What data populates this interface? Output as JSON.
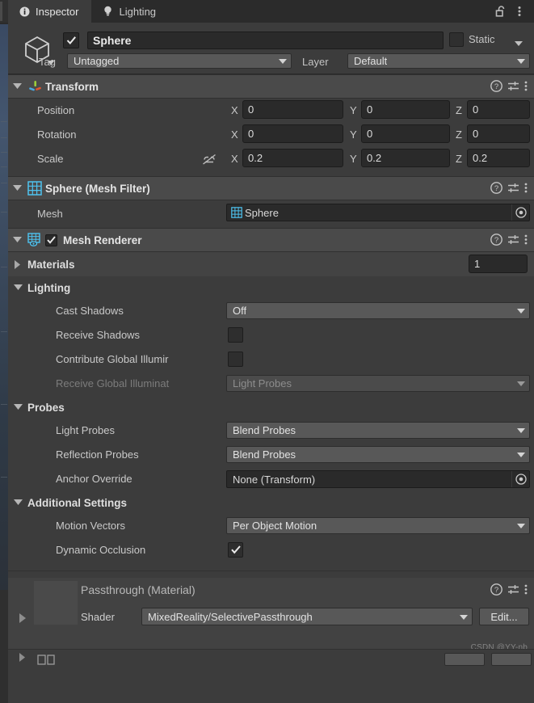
{
  "window": {
    "tabs": [
      {
        "label": "Inspector",
        "icon": "info-icon",
        "active": true
      },
      {
        "label": "Lighting",
        "icon": "lightbulb-icon",
        "active": false
      }
    ],
    "lock_icon": "unlocked-padlock-icon",
    "menu_icon": "kebab-menu-icon"
  },
  "object_header": {
    "prefab_icon": "cube-icon",
    "enabled": true,
    "name": "Sphere",
    "static_checked": false,
    "static_label": "Static",
    "tag_label": "Tag",
    "tag_value": "Untagged",
    "layer_label": "Layer",
    "layer_value": "Default"
  },
  "components": [
    {
      "id": "transform",
      "title": "Transform",
      "icon": "transform-axis-gizmo-icon",
      "expanded": true,
      "has_checkbox": false,
      "help_icon": "help-icon",
      "preset_icon": "preset-sliders-icon",
      "menu_icon": "kebab-menu-icon",
      "rows": [
        {
          "label": "Position",
          "x": "0",
          "y": "0",
          "z": "0",
          "lock_icon": null
        },
        {
          "label": "Rotation",
          "x": "0",
          "y": "0",
          "z": "0",
          "lock_icon": null
        },
        {
          "label": "Scale",
          "x": "0.2",
          "y": "0.2",
          "z": "0.2",
          "lock_icon": "constrained-proportions-off-icon"
        }
      ],
      "axis_labels": {
        "x": "X",
        "y": "Y",
        "z": "Z"
      }
    },
    {
      "id": "mesh-filter",
      "title": "Sphere (Mesh Filter)",
      "icon": "mesh-filter-grid-icon",
      "expanded": true,
      "has_checkbox": false,
      "mesh_label": "Mesh",
      "mesh_value": "Sphere",
      "mesh_value_icon": "mesh-grid-icon",
      "picker_icon": "object-picker-icon"
    },
    {
      "id": "mesh-renderer",
      "title": "Mesh Renderer",
      "icon": "mesh-renderer-icon",
      "expanded": true,
      "has_checkbox": true,
      "checked": true,
      "materials": {
        "label": "Materials",
        "count": "1",
        "expanded": false
      },
      "groups": [
        {
          "name": "Lighting",
          "expanded": true,
          "fields": [
            {
              "type": "dropdown",
              "label": "Cast Shadows",
              "value": "Off",
              "disabled": false
            },
            {
              "type": "checkbox",
              "label": "Receive Shadows",
              "checked": false,
              "disabled": false
            },
            {
              "type": "checkbox",
              "label": "Contribute Global Illumir",
              "checked": false,
              "disabled": false
            },
            {
              "type": "dropdown",
              "label": "Receive Global Illuminat",
              "value": "Light Probes",
              "disabled": true
            }
          ]
        },
        {
          "name": "Probes",
          "expanded": true,
          "fields": [
            {
              "type": "dropdown",
              "label": "Light Probes",
              "value": "Blend Probes",
              "disabled": false
            },
            {
              "type": "dropdown",
              "label": "Reflection Probes",
              "value": "Blend Probes",
              "disabled": false
            },
            {
              "type": "object",
              "label": "Anchor Override",
              "value": "None (Transform)",
              "picker_icon": "object-picker-icon"
            }
          ]
        },
        {
          "name": "Additional Settings",
          "expanded": true,
          "fields": [
            {
              "type": "dropdown",
              "label": "Motion Vectors",
              "value": "Per Object Motion",
              "disabled": false
            },
            {
              "type": "checkbox",
              "label": "Dynamic Occlusion",
              "checked": true,
              "disabled": false
            }
          ]
        }
      ]
    }
  ],
  "material_editor": {
    "title": "Passthrough (Material)",
    "shader_label": "Shader",
    "shader_value": "MixedReality/SelectivePassthrough",
    "edit_button": "Edit...",
    "help_icon": "help-icon",
    "preset_icon": "preset-sliders-icon",
    "menu_icon": "kebab-menu-icon",
    "foldout_icon": "collapsed-triangle-icon"
  },
  "watermark": "CSDN @YY-nb",
  "colors": {
    "panel_bg": "#3c3c3c",
    "header_bg": "#4a4a4a",
    "tabbar_bg": "#2b2b2b",
    "field_bg": "#2a2a2a",
    "dropdown_bg": "#585858",
    "text": "#c9c9c9",
    "accent_blue": "#4ec3f0",
    "axis_green": "#8bc34a",
    "axis_red": "#e05a3a",
    "axis_blue": "#4aa8e0"
  }
}
